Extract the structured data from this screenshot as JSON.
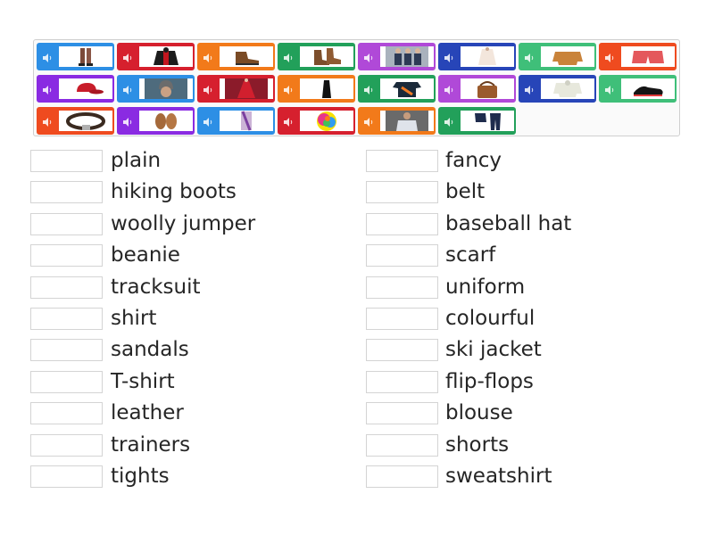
{
  "colors": {
    "blue": "#2d8fe5",
    "red": "#d6202e",
    "orange": "#f27a1a",
    "green": "#22a05a",
    "violet": "#b049d8",
    "navy": "#2745b8",
    "teal": "#3fbf79",
    "purple": "#8a2be2",
    "red_orange": "#ef4b1f"
  },
  "tiles": [
    {
      "icon": "tights-legs-photo",
      "color": "#2d8fe5"
    },
    {
      "icon": "ski-jacket-photo",
      "color": "#d6202e"
    },
    {
      "icon": "hiking-boot-photo",
      "color": "#f27a1a"
    },
    {
      "icon": "leather-boots-photo",
      "color": "#22a05a"
    },
    {
      "icon": "uniform-people-photo",
      "color": "#b049d8"
    },
    {
      "icon": "blouse-photo",
      "color": "#2745b8"
    },
    {
      "icon": "woolly-jumper-photo",
      "color": "#3fbf79"
    },
    {
      "icon": "shorts-photo",
      "color": "#ef4b1f"
    },
    {
      "icon": "baseball-hat-photo",
      "color": "#8a2be2"
    },
    {
      "icon": "beanie-photo",
      "color": "#2d8fe5"
    },
    {
      "icon": "fancy-dress-photo",
      "color": "#d6202e"
    },
    {
      "icon": "plain-black-dress-photo",
      "color": "#f27a1a"
    },
    {
      "icon": "t-shirt-photo",
      "color": "#22a05a"
    },
    {
      "icon": "leather-bag-photo",
      "color": "#b049d8"
    },
    {
      "icon": "sweatshirt-photo",
      "color": "#2745b8"
    },
    {
      "icon": "trainers-photo",
      "color": "#3fbf79"
    },
    {
      "icon": "belt-photo",
      "color": "#ef4b1f"
    },
    {
      "icon": "sandals-photo",
      "color": "#8a2be2"
    },
    {
      "icon": "scarf-photo",
      "color": "#2d8fe5"
    },
    {
      "icon": "colourful-rose-photo",
      "color": "#d6202e"
    },
    {
      "icon": "shirt-man-photo",
      "color": "#f27a1a"
    },
    {
      "icon": "tracksuit-photo",
      "color": "#22a05a"
    }
  ],
  "words_left": [
    "plain",
    "hiking boots",
    "woolly jumper",
    "beanie",
    "tracksuit",
    "shirt",
    "sandals",
    "T-shirt",
    "leather",
    "trainers",
    "tights"
  ],
  "words_right": [
    "fancy",
    "belt",
    "baseball hat",
    "scarf",
    "uniform",
    "colourful",
    "ski jacket",
    "flip-flops",
    "blouse",
    "shorts",
    "sweatshirt"
  ]
}
